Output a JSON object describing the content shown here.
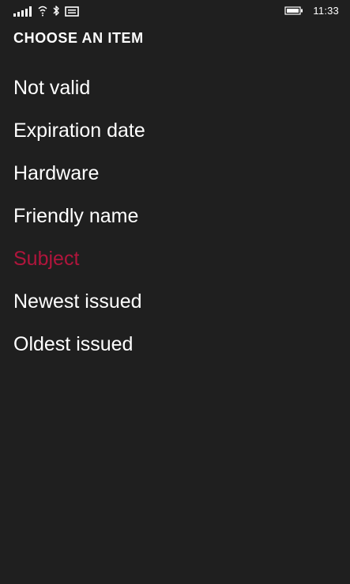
{
  "status_bar": {
    "time": "11:33",
    "icons": [
      "signal-strength-icon",
      "wifi-icon",
      "bluetooth-icon",
      "message-icon",
      "battery-icon"
    ]
  },
  "picker": {
    "title": "CHOOSE AN ITEM",
    "items": [
      {
        "label": "Not valid",
        "selected": false
      },
      {
        "label": "Expiration date",
        "selected": false
      },
      {
        "label": "Hardware",
        "selected": false
      },
      {
        "label": "Friendly name",
        "selected": false
      },
      {
        "label": "Subject",
        "selected": true
      },
      {
        "label": "Newest issued",
        "selected": false
      },
      {
        "label": "Oldest issued",
        "selected": false
      }
    ]
  },
  "colors": {
    "background": "#1f1f1f",
    "text": "#ffffff",
    "accent": "#b0153c"
  }
}
